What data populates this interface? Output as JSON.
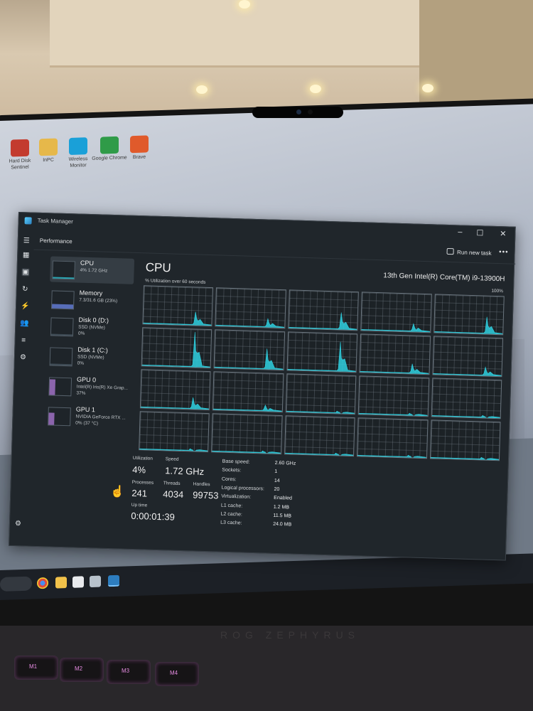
{
  "desktop": {
    "icons": [
      {
        "label": "Hard Disk Sentinel",
        "color": "#c33b2e"
      },
      {
        "label": "InPC",
        "color": "#e6b84a"
      },
      {
        "label": "Wireless Monitor",
        "color": "#1aa0d8"
      },
      {
        "label": "Google Chrome",
        "color": "#2f9b48"
      },
      {
        "label": "Brave",
        "color": "#e05a2b"
      }
    ]
  },
  "window": {
    "title": "Task Manager",
    "page": "Performance",
    "run_new_task": "Run new task",
    "more": "•••",
    "minimize": "–",
    "maximize": "☐",
    "close": "✕"
  },
  "nav_icons": [
    "menu-icon",
    "processes-icon",
    "performance-icon",
    "history-icon",
    "startup-icon",
    "users-icon",
    "details-icon",
    "services-icon",
    "settings-icon"
  ],
  "devices": [
    {
      "name": "CPU",
      "sub1": "4%  1.72 GHz",
      "sub2": ""
    },
    {
      "name": "Memory",
      "sub1": "7.3/31.6 GB (23%)",
      "sub2": ""
    },
    {
      "name": "Disk 0 (D:)",
      "sub1": "SSD (NVMe)",
      "sub2": "0%"
    },
    {
      "name": "Disk 1 (C:)",
      "sub1": "SSD (NVMe)",
      "sub2": "0%"
    },
    {
      "name": "GPU 0",
      "sub1": "Intel(R) Iris(R) Xe Grap...",
      "sub2": "37%"
    },
    {
      "name": "GPU 1",
      "sub1": "NVIDIA GeForce RTX ...",
      "sub2": "0% (37 °C)"
    }
  ],
  "main": {
    "title": "CPU",
    "model": "13th Gen Intel(R) Core(TM) i9-13900H",
    "util_label": "% Utilization over 60 seconds",
    "max_label": "100%",
    "accent": "#2fd0e0"
  },
  "core_peaks": [
    [
      0.35,
      0.22,
      0.45,
      0.2,
      0.45
    ],
    [
      0.95,
      0.55,
      0.8,
      0.25,
      0.22
    ],
    [
      0.3,
      0.15,
      0.02,
      0.02,
      0.02
    ],
    [
      0.02,
      0.02,
      0.02,
      0.02,
      0.02
    ]
  ],
  "stats": {
    "utilization_label": "Utilization",
    "utilization": "4%",
    "speed_label": "Speed",
    "speed": "1.72 GHz",
    "processes_label": "Processes",
    "processes": "241",
    "threads_label": "Threads",
    "threads": "4034",
    "handles_label": "Handles",
    "handles": "99753",
    "uptime_label": "Up time",
    "uptime": "0:00:01:39"
  },
  "specs": [
    {
      "k": "Base speed:",
      "v": "2.60 GHz"
    },
    {
      "k": "Sockets:",
      "v": "1"
    },
    {
      "k": "Cores:",
      "v": "14"
    },
    {
      "k": "Logical processors:",
      "v": "20"
    },
    {
      "k": "Virtualization:",
      "v": "Enabled"
    },
    {
      "k": "L1 cache:",
      "v": "1.2 MB"
    },
    {
      "k": "L2 cache:",
      "v": "11.5 MB"
    },
    {
      "k": "L3 cache:",
      "v": "24.0 MB"
    }
  ],
  "keyboard": {
    "brand": "ROG ZEPHYRUS",
    "keys": [
      "M1",
      "M2",
      "M3",
      "M4"
    ]
  }
}
